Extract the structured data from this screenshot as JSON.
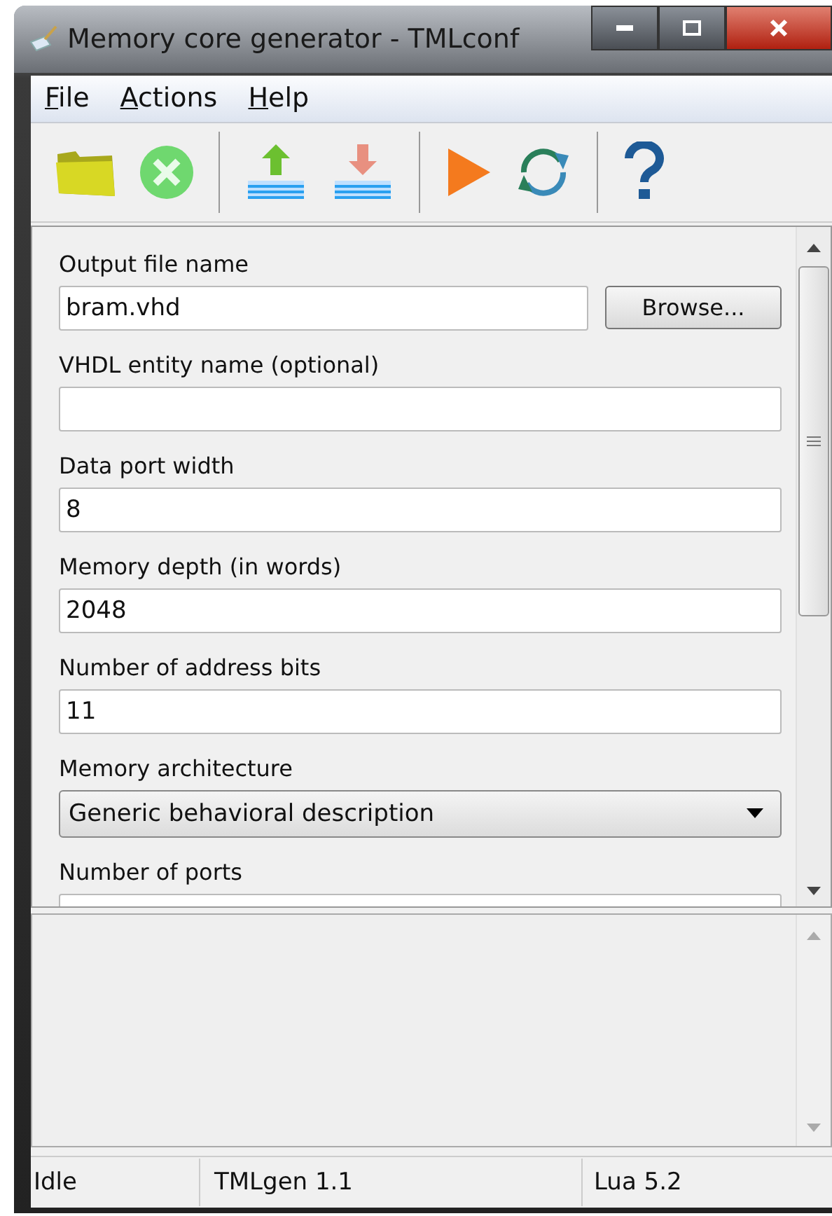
{
  "window": {
    "title": "Memory core generator - TMLconf"
  },
  "menu": [
    "File",
    "Actions",
    "Help"
  ],
  "toolbar": [
    {
      "kind": "folder"
    },
    {
      "kind": "cancel"
    },
    {
      "kind": "separator"
    },
    {
      "kind": "upload"
    },
    {
      "kind": "download"
    },
    {
      "kind": "separator"
    },
    {
      "kind": "run"
    },
    {
      "kind": "refresh"
    },
    {
      "kind": "separator"
    },
    {
      "kind": "help"
    }
  ],
  "form": [
    {
      "kind": "text",
      "label": "Output file name",
      "value": "bram.vhd",
      "button": "Browse..."
    },
    {
      "kind": "text",
      "label": "VHDL entity name (optional)"
    },
    {
      "kind": "text",
      "label": "Data port width",
      "value": "8"
    },
    {
      "kind": "text",
      "label": "Memory depth (in words)",
      "value": "2048"
    },
    {
      "kind": "text",
      "label": "Number of address bits",
      "value": "11"
    },
    {
      "kind": "select",
      "label": "Memory architecture",
      "value": "Generic behavioral description"
    },
    {
      "kind": "text",
      "label": "Number of ports"
    }
  ],
  "status_bar": [
    "Idle",
    "TMLgen 1.1",
    "Lua 5.2"
  ]
}
